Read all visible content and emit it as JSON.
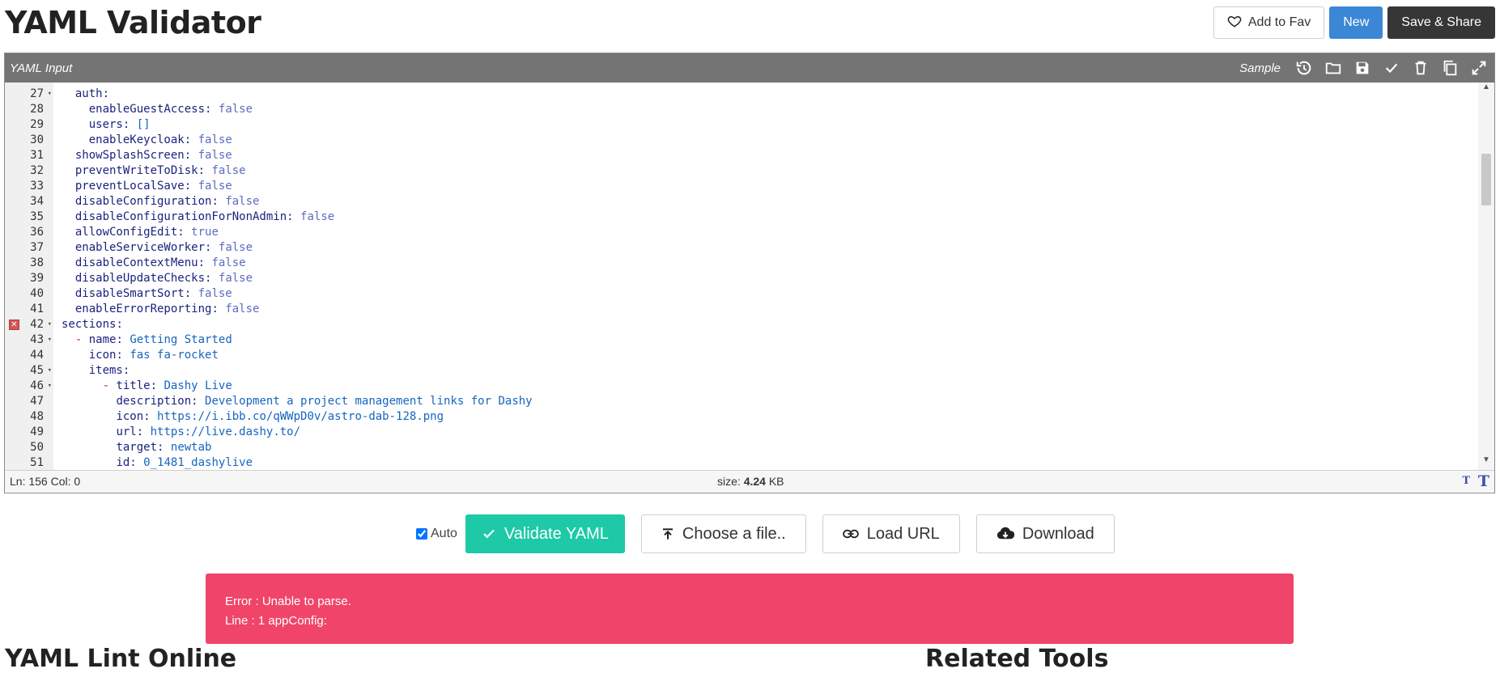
{
  "page": {
    "title": "YAML Validator",
    "actions": {
      "fav": "Add to Fav",
      "new": "New",
      "share": "Save & Share"
    }
  },
  "editor": {
    "label": "YAML Input",
    "sample": "Sample",
    "tools": [
      "history-icon",
      "open-folder-icon",
      "save-icon",
      "check-icon",
      "trash-icon",
      "copy-icon",
      "expand-icon"
    ],
    "lines": [
      {
        "n": "27",
        "indent": "  ",
        "key": "auth",
        "val": "",
        "fold": true
      },
      {
        "n": "28",
        "indent": "    ",
        "key": "enableGuestAccess",
        "val": "false",
        "bool": true
      },
      {
        "n": "29",
        "indent": "    ",
        "key": "users",
        "val": "[]"
      },
      {
        "n": "30",
        "indent": "    ",
        "key": "enableKeycloak",
        "val": "false",
        "bool": true
      },
      {
        "n": "31",
        "indent": "  ",
        "key": "showSplashScreen",
        "val": "false",
        "bool": true
      },
      {
        "n": "32",
        "indent": "  ",
        "key": "preventWriteToDisk",
        "val": "false",
        "bool": true
      },
      {
        "n": "33",
        "indent": "  ",
        "key": "preventLocalSave",
        "val": "false",
        "bool": true
      },
      {
        "n": "34",
        "indent": "  ",
        "key": "disableConfiguration",
        "val": "false",
        "bool": true
      },
      {
        "n": "35",
        "indent": "  ",
        "key": "disableConfigurationForNonAdmin",
        "val": "false",
        "bool": true
      },
      {
        "n": "36",
        "indent": "  ",
        "key": "allowConfigEdit",
        "val": "true",
        "bool": true
      },
      {
        "n": "37",
        "indent": "  ",
        "key": "enableServiceWorker",
        "val": "false",
        "bool": true
      },
      {
        "n": "38",
        "indent": "  ",
        "key": "disableContextMenu",
        "val": "false",
        "bool": true
      },
      {
        "n": "39",
        "indent": "  ",
        "key": "disableUpdateChecks",
        "val": "false",
        "bool": true
      },
      {
        "n": "40",
        "indent": "  ",
        "key": "disableSmartSort",
        "val": "false",
        "bool": true
      },
      {
        "n": "41",
        "indent": "  ",
        "key": "enableErrorReporting",
        "val": "false",
        "bool": true
      },
      {
        "n": "42",
        "indent": "",
        "key": "sections",
        "val": "",
        "fold": true,
        "error": true
      },
      {
        "n": "43",
        "indent": "  ",
        "dash": true,
        "key": "name",
        "val": "Getting Started",
        "fold": true
      },
      {
        "n": "44",
        "indent": "    ",
        "key": "icon",
        "val": "fas fa-rocket"
      },
      {
        "n": "45",
        "indent": "    ",
        "key": "items",
        "val": "",
        "fold": true
      },
      {
        "n": "46",
        "indent": "      ",
        "dash": true,
        "key": "title",
        "val": "Dashy Live",
        "fold": true
      },
      {
        "n": "47",
        "indent": "        ",
        "key": "description",
        "val": "Development a project management links for Dashy"
      },
      {
        "n": "48",
        "indent": "        ",
        "key": "icon",
        "val": "https://i.ibb.co/qWWpD0v/astro-dab-128.png"
      },
      {
        "n": "49",
        "indent": "        ",
        "key": "url",
        "val": "https://live.dashy.to/"
      },
      {
        "n": "50",
        "indent": "        ",
        "key": "target",
        "val": "newtab"
      },
      {
        "n": "51",
        "indent": "        ",
        "key": "id",
        "val": "0_1481_dashylive"
      }
    ],
    "status": {
      "position": "Ln: 156 Col: 0",
      "size_label": "size:",
      "size_value": "4.24",
      "size_unit": "KB"
    }
  },
  "controls": {
    "auto_label": "Auto",
    "auto_checked": true,
    "validate": "Validate YAML",
    "choose_file": "Choose a file..",
    "load_url": "Load URL",
    "download": "Download"
  },
  "error": {
    "line1": "Error : Unable to parse.",
    "line2": "Line : 1 appConfig:"
  },
  "footer": {
    "left_heading": "YAML Lint Online",
    "right_heading": "Related Tools"
  },
  "colors": {
    "header_bg": "#747474",
    "new_btn": "#3b87d6",
    "share_btn": "#363636",
    "validate_btn": "#1dc9a6",
    "error_bg": "#f04569"
  }
}
